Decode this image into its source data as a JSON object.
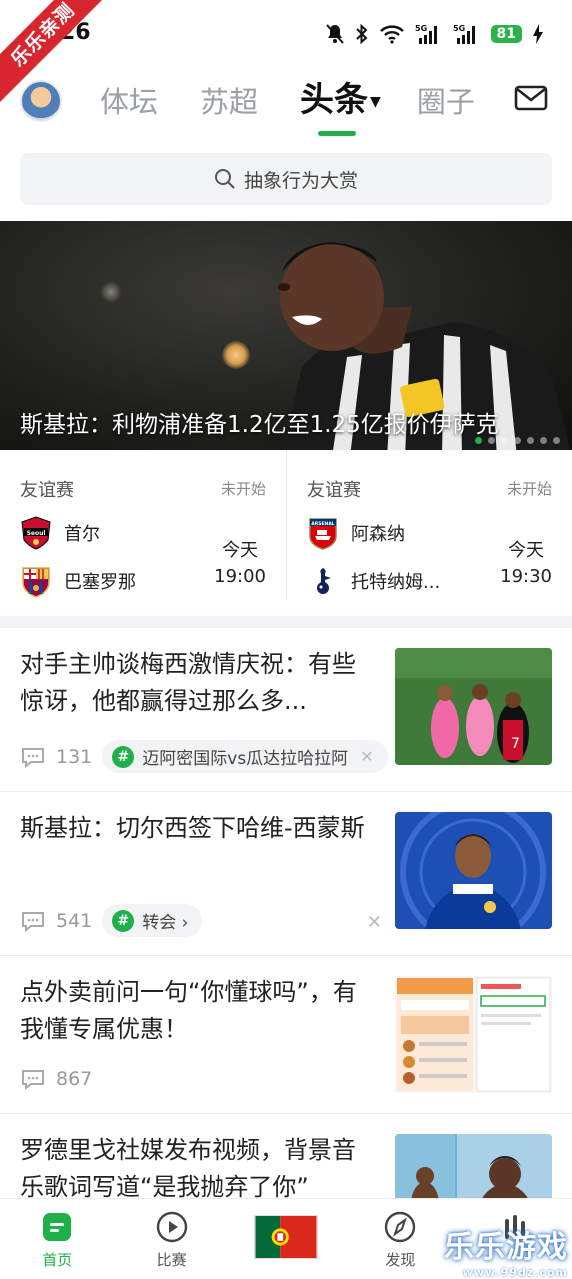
{
  "status_bar": {
    "time": "26",
    "battery": "81",
    "corner_badge": "乐乐亲测"
  },
  "top_nav": {
    "tabs": [
      {
        "label": "体坛",
        "active": false
      },
      {
        "label": "苏超",
        "active": false
      },
      {
        "label": "头条",
        "active": true
      },
      {
        "label": "圈子",
        "active": false
      }
    ]
  },
  "search": {
    "placeholder": "抽象行为大赏"
  },
  "banner": {
    "title": "斯基拉：利物浦准备1.2亿至1.25亿报价伊萨克",
    "slide_count": 7,
    "active_slide": 1
  },
  "matches": [
    {
      "competition": "友谊赛",
      "state": "未开始",
      "home": "首尔",
      "away": "巴塞罗那",
      "day": "今天",
      "time": "19:00"
    },
    {
      "competition": "友谊赛",
      "state": "未开始",
      "home": "阿森纳",
      "away": "托特纳姆...",
      "day": "今天",
      "time": "19:30"
    }
  ],
  "feed": [
    {
      "title": "对手主帅谈梅西激情庆祝：有些惊讶，他都赢得过那么多...",
      "comments": "131",
      "tag": "迈阿密国际vs瓜达拉哈拉阿",
      "tag_close": "✕"
    },
    {
      "title": "斯基拉：切尔西签下哈维-西蒙斯",
      "comments": "541",
      "tag": "转会 ›",
      "dismiss": "✕"
    },
    {
      "title": "点外卖前问一句“你懂球吗”，有我懂专属优惠！",
      "comments": "867"
    },
    {
      "title": "罗德里戈社媒发布视频，背景音乐歌词写道“是我抛弃了你”"
    }
  ],
  "bottom_nav": [
    {
      "label": "首页",
      "active": true,
      "icon": "home-icon"
    },
    {
      "label": "比赛",
      "active": false,
      "icon": "play-icon"
    },
    {
      "label": "",
      "active": false,
      "icon": "portugal-flag-icon"
    },
    {
      "label": "发现",
      "active": false,
      "icon": "discover-icon"
    },
    {
      "label": "",
      "active": false,
      "icon": "community-icon"
    }
  ],
  "watermark": {
    "text": "乐乐游戏",
    "sub": "www.99dz.com"
  },
  "colors": {
    "accent": "#20b04a",
    "badge": "#d8262f"
  }
}
